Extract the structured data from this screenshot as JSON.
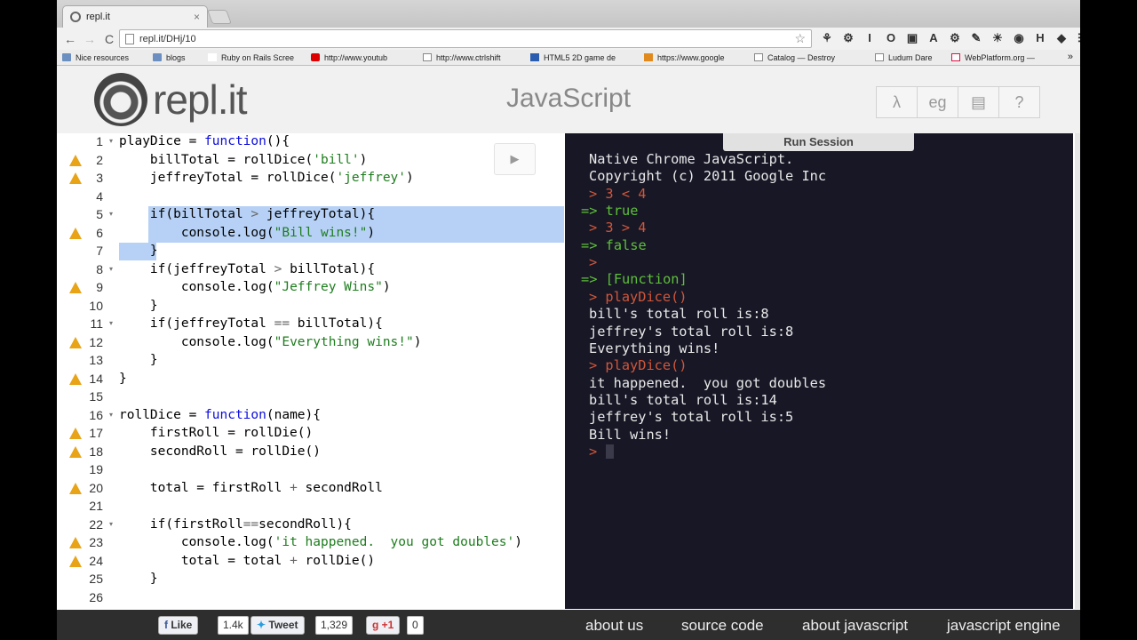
{
  "browser": {
    "tab_title": "repl.it",
    "tab_close": "×",
    "url": "repl.it/DHj/10",
    "nav": {
      "back": "←",
      "forward": "→",
      "reload": "C"
    },
    "bookmark_star": "☆",
    "extensions": [
      "⚘",
      "⚙",
      "I",
      "O",
      "▣",
      "A",
      "⚙",
      "✎",
      "☀",
      "◉",
      "H",
      "◆",
      "☰"
    ],
    "bookmarks": [
      {
        "label": "Nice resources",
        "icon": "folder"
      },
      {
        "label": "blogs",
        "icon": "folder"
      },
      {
        "label": "Ruby on Rails Scree",
        "icon": "rr"
      },
      {
        "label": "http://www.youtub",
        "icon": "yt"
      },
      {
        "label": "http://www.ctrlshift",
        "icon": "page"
      },
      {
        "label": "HTML5 2D game de",
        "icon": "blu"
      },
      {
        "label": "https://www.google",
        "icon": "org"
      },
      {
        "label": "Catalog — Destroy",
        "icon": "page"
      },
      {
        "label": "Ludum Dare",
        "icon": "page"
      },
      {
        "label": "WebPlatform.org —",
        "icon": "wp"
      }
    ],
    "bookmarks_more": "»"
  },
  "header": {
    "logo_text": "repl.it",
    "language": "JavaScript",
    "buttons": [
      {
        "label": "λ",
        "name": "lambda-button"
      },
      {
        "label": "eg",
        "name": "examples-button"
      },
      {
        "label": "▤",
        "name": "save-button"
      },
      {
        "label": "?",
        "name": "help-button"
      }
    ]
  },
  "editor": {
    "run_icon": "▶",
    "lines": [
      {
        "n": "1",
        "warn": false,
        "fold": true,
        "tokens": [
          [
            "",
            "playDice = "
          ],
          [
            "kw",
            "function"
          ],
          [
            "",
            "(){"
          ]
        ]
      },
      {
        "n": "2",
        "warn": true,
        "fold": false,
        "tokens": [
          [
            "",
            "    billTotal = rollDice("
          ],
          [
            "str",
            "'bill'"
          ],
          [
            "",
            ")"
          ]
        ]
      },
      {
        "n": "3",
        "warn": true,
        "fold": false,
        "tokens": [
          [
            "",
            "    jeffreyTotal = rollDice("
          ],
          [
            "str",
            "'jeffrey'"
          ],
          [
            "",
            ")"
          ]
        ]
      },
      {
        "n": "4",
        "warn": false,
        "fold": false,
        "tokens": []
      },
      {
        "n": "5",
        "warn": false,
        "fold": true,
        "tokens": [
          [
            "",
            "    if(billTotal "
          ],
          [
            "op",
            ">"
          ],
          [
            "",
            " jeffreyTotal){"
          ]
        ]
      },
      {
        "n": "6",
        "warn": true,
        "fold": false,
        "tokens": [
          [
            "",
            "        console.log("
          ],
          [
            "str",
            "\"Bill wins!\""
          ],
          [
            "",
            ")"
          ]
        ]
      },
      {
        "n": "7",
        "warn": false,
        "fold": false,
        "tokens": [
          [
            "",
            "    }"
          ]
        ]
      },
      {
        "n": "8",
        "warn": false,
        "fold": true,
        "tokens": [
          [
            "",
            "    if(jeffreyTotal "
          ],
          [
            "op",
            ">"
          ],
          [
            "",
            " billTotal){"
          ]
        ]
      },
      {
        "n": "9",
        "warn": true,
        "fold": false,
        "tokens": [
          [
            "",
            "        console.log("
          ],
          [
            "str",
            "\"Jeffrey Wins\""
          ],
          [
            "",
            ")"
          ]
        ]
      },
      {
        "n": "10",
        "warn": false,
        "fold": false,
        "tokens": [
          [
            "",
            "    }"
          ]
        ]
      },
      {
        "n": "11",
        "warn": false,
        "fold": true,
        "tokens": [
          [
            "",
            "    if(jeffreyTotal "
          ],
          [
            "op",
            "=="
          ],
          [
            "",
            " billTotal){"
          ]
        ]
      },
      {
        "n": "12",
        "warn": true,
        "fold": false,
        "tokens": [
          [
            "",
            "        console.log("
          ],
          [
            "str",
            "\"Everything wins!\""
          ],
          [
            "",
            ")"
          ]
        ]
      },
      {
        "n": "13",
        "warn": false,
        "fold": false,
        "tokens": [
          [
            "",
            "    }"
          ]
        ]
      },
      {
        "n": "14",
        "warn": true,
        "fold": false,
        "tokens": [
          [
            "",
            "}"
          ]
        ]
      },
      {
        "n": "15",
        "warn": false,
        "fold": false,
        "tokens": []
      },
      {
        "n": "16",
        "warn": false,
        "fold": true,
        "tokens": [
          [
            "",
            "rollDice = "
          ],
          [
            "kw",
            "function"
          ],
          [
            "",
            "(name){"
          ]
        ]
      },
      {
        "n": "17",
        "warn": true,
        "fold": false,
        "tokens": [
          [
            "",
            "    firstRoll = rollDie()"
          ]
        ]
      },
      {
        "n": "18",
        "warn": true,
        "fold": false,
        "tokens": [
          [
            "",
            "    secondRoll = rollDie()"
          ]
        ]
      },
      {
        "n": "19",
        "warn": false,
        "fold": false,
        "tokens": []
      },
      {
        "n": "20",
        "warn": true,
        "fold": false,
        "tokens": [
          [
            "",
            "    total = firstRoll "
          ],
          [
            "op",
            "+"
          ],
          [
            "",
            " secondRoll"
          ]
        ]
      },
      {
        "n": "21",
        "warn": false,
        "fold": false,
        "tokens": []
      },
      {
        "n": "22",
        "warn": false,
        "fold": true,
        "tokens": [
          [
            "",
            "    if(firstRoll"
          ],
          [
            "op",
            "=="
          ],
          [
            "",
            "secondRoll){"
          ]
        ]
      },
      {
        "n": "23",
        "warn": true,
        "fold": false,
        "tokens": [
          [
            "",
            "        console.log("
          ],
          [
            "str",
            "'it happened.  you got doubles'"
          ],
          [
            "",
            ")"
          ]
        ]
      },
      {
        "n": "24",
        "warn": true,
        "fold": false,
        "tokens": [
          [
            "",
            "        total = total "
          ],
          [
            "op",
            "+"
          ],
          [
            "",
            " rollDie()"
          ]
        ]
      },
      {
        "n": "25",
        "warn": false,
        "fold": false,
        "tokens": [
          [
            "",
            "    }"
          ]
        ]
      },
      {
        "n": "26",
        "warn": false,
        "fold": false,
        "tokens": []
      }
    ]
  },
  "console": {
    "header": "Run Session",
    "lines": [
      {
        "type": "out",
        "text": "Native Chrome JavaScript."
      },
      {
        "type": "out",
        "text": "Copyright (c) 2011 Google Inc"
      },
      {
        "type": "inp",
        "text": "> 3 < 4"
      },
      {
        "type": "res",
        "text": "=> true"
      },
      {
        "type": "inp",
        "text": "> 3 > 4"
      },
      {
        "type": "res",
        "text": "=> false"
      },
      {
        "type": "inp",
        "text": ">"
      },
      {
        "type": "res",
        "text": "=> [Function]"
      },
      {
        "type": "inp",
        "text": "> playDice()"
      },
      {
        "type": "out",
        "text": "bill's total roll is:8"
      },
      {
        "type": "out",
        "text": "jeffrey's total roll is:8"
      },
      {
        "type": "out",
        "text": "Everything wins!"
      },
      {
        "type": "inp",
        "text": "> playDice()"
      },
      {
        "type": "out",
        "text": "it happened.  you got doubles"
      },
      {
        "type": "out",
        "text": "bill's total roll is:14"
      },
      {
        "type": "out",
        "text": "jeffrey's total roll is:5"
      },
      {
        "type": "out",
        "text": "Bill wins!"
      },
      {
        "type": "inp",
        "text": ">"
      }
    ]
  },
  "footer": {
    "like_label": "Like",
    "like_count": "1.4k",
    "tweet_label": "Tweet",
    "tweet_count": "1,329",
    "gplus_label": "+1",
    "gplus_count": "0",
    "links": [
      "about us",
      "source code",
      "about javascript",
      "javascript engine"
    ]
  }
}
